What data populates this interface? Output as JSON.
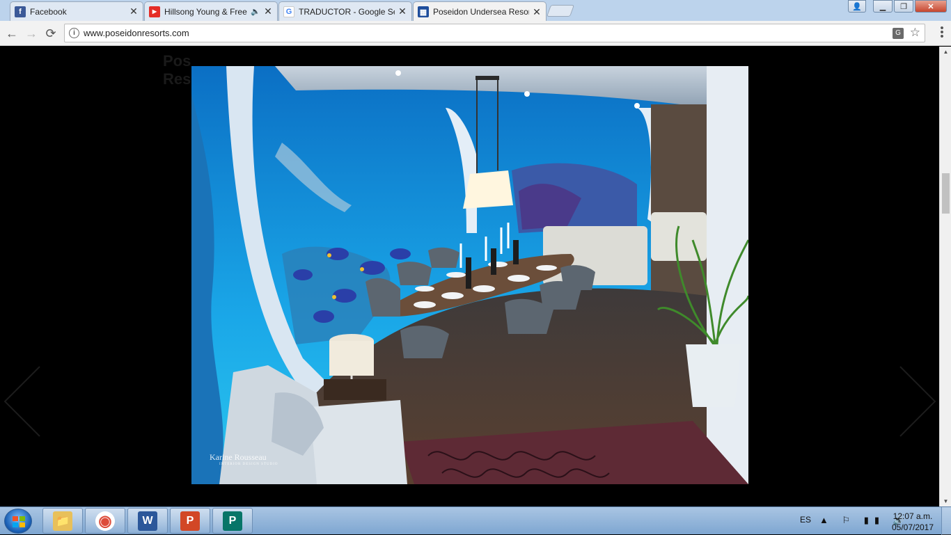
{
  "browser": {
    "tabs": [
      {
        "title": "Facebook",
        "icon": "facebook-icon",
        "favicon_color": "#3b5998",
        "favicon_glyph": "f",
        "active": false,
        "audio": false
      },
      {
        "title": "Hillsong Young & Free",
        "icon": "youtube-icon",
        "favicon_color": "#e52d27",
        "favicon_glyph": "▶",
        "active": false,
        "audio": true
      },
      {
        "title": "TRADUCTOR - Google Se",
        "icon": "google-icon",
        "favicon_color": "#4285f4",
        "favicon_glyph": "G",
        "active": false,
        "audio": false
      },
      {
        "title": "Poseidon Undersea Resor",
        "icon": "site-grid-icon",
        "favicon_color": "#1f4e9c",
        "favicon_glyph": "▦",
        "active": true,
        "audio": false
      }
    ],
    "close_glyph": "✕",
    "audio_glyph": "🔈",
    "window_controls": {
      "user": "👤",
      "minimize": "▁",
      "maximize": "❐",
      "close": "✕"
    },
    "toolbar": {
      "back": "←",
      "forward": "→",
      "reload": "⟳",
      "info": "i",
      "translate": "G",
      "star": "☆",
      "menu": "⋮"
    },
    "url": "www.poseidonresorts.com"
  },
  "page": {
    "background_logo": "Pos\nRes",
    "watermark": {
      "name": "Karine Rousseau",
      "subtitle": "INTERIOR DESIGN STUDIO"
    },
    "colors": {
      "water": "#1f8fd6",
      "floor": "#5a4030",
      "rug": "#5e2a35",
      "accent": "#f0c030"
    }
  },
  "scrollbar": {
    "up": "▲",
    "down": "▼"
  },
  "taskbar": {
    "apps": [
      {
        "name": "file-explorer-icon",
        "glyph": "📁",
        "color": "#e8c05a"
      },
      {
        "name": "chrome-icon",
        "glyph": "◉",
        "color": "#dd4b39"
      },
      {
        "name": "word-icon",
        "glyph": "W",
        "color": "#2b579a"
      },
      {
        "name": "powerpoint-icon",
        "glyph": "P",
        "color": "#d24726"
      },
      {
        "name": "publisher-icon",
        "glyph": "P",
        "color": "#077568"
      }
    ],
    "language": "ES",
    "tray_icons": "▲ ⚐ ▮▮ 🔊",
    "time": "12:07 a.m.",
    "date": "05/07/2017"
  }
}
